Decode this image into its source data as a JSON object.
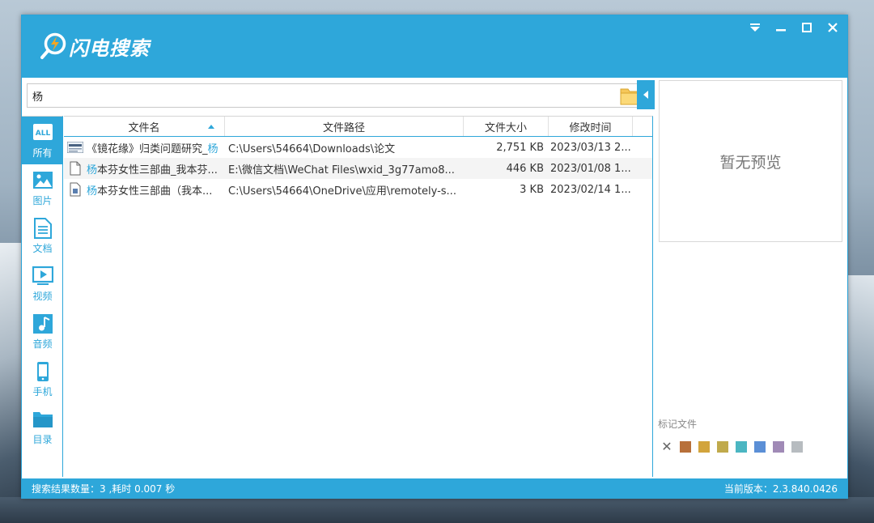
{
  "app": {
    "title": "闪电搜索",
    "window_controls": [
      "menu",
      "minimize",
      "maximize",
      "close"
    ]
  },
  "search": {
    "value": "杨",
    "folder_icon": "folder-icon"
  },
  "categories": [
    {
      "label": "所有",
      "icon": "all-icon",
      "active": true
    },
    {
      "label": "图片",
      "icon": "image-icon",
      "active": false
    },
    {
      "label": "文档",
      "icon": "document-icon",
      "active": false
    },
    {
      "label": "视频",
      "icon": "video-icon",
      "active": false
    },
    {
      "label": "音频",
      "icon": "audio-icon",
      "active": false
    },
    {
      "label": "手机",
      "icon": "phone-icon",
      "active": false
    },
    {
      "label": "目录",
      "icon": "directory-icon",
      "active": false
    }
  ],
  "table": {
    "headers": {
      "name": "文件名",
      "path": "文件路径",
      "size": "文件大小",
      "time": "修改时间"
    },
    "sort": {
      "column": "name",
      "direction": "ascending"
    },
    "rows": [
      {
        "icon": "document-thumbnail-icon",
        "name_prefix": "《镜花缘》归类问题研究_",
        "name_highlight": "杨",
        "name_suffix": "",
        "path": "C:\\Users\\54664\\Downloads\\论文",
        "size": "2,751 KB",
        "time": "2023/03/13 2..."
      },
      {
        "icon": "text-file-icon",
        "name_prefix": "",
        "name_highlight": "杨",
        "name_suffix": "本芬女性三部曲_我本芬...",
        "path": "E:\\微信文档\\WeChat Files\\wxid_3g77amo8...",
        "size": "446 KB",
        "time": "2023/01/08 1..."
      },
      {
        "icon": "ebook-file-icon",
        "name_prefix": "",
        "name_highlight": "杨",
        "name_suffix": "本芬女性三部曲（我本...",
        "path": "C:\\Users\\54664\\OneDrive\\应用\\remotely-s...",
        "size": "3 KB",
        "time": "2023/02/14 1..."
      }
    ]
  },
  "preview": {
    "placeholder": "暂无预览"
  },
  "marks": {
    "label": "标记文件",
    "colors": [
      "#b8703a",
      "#d2a43c",
      "#c0aa4c",
      "#4bb6c2",
      "#5b8fd6",
      "#a08ab6",
      "#b7bcc0"
    ]
  },
  "status": {
    "left": "搜索结果数量：3 ,耗时 0.007 秒",
    "right": "当前版本：2.3.840.0426"
  },
  "colors": {
    "accent": "#2ea7da"
  }
}
